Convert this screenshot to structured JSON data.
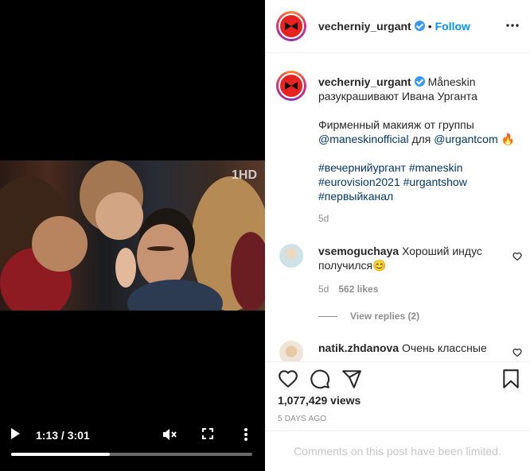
{
  "video": {
    "channel_logo": "1HD",
    "time": "1:13 / 3:01",
    "progress": 0.41,
    "icons": [
      "play-icon",
      "mute-icon",
      "fullscreen-icon",
      "more-vertical-icon"
    ]
  },
  "header": {
    "username": "vecherniy_urgant",
    "separator": "•",
    "follow_label": "Follow"
  },
  "caption": {
    "username": "vecherniy_urgant",
    "line1": "Måneskin разукрашивают Ивана Урганта",
    "line2_prefix": "Фирменный макияж от группы",
    "mention1": "@maneskinofficial",
    "line2_mid": "для",
    "mention2": "@urgantcom",
    "emoji": "🔥",
    "hashtags": [
      "#вечернийургант",
      "#maneskin",
      "#eurovision2021",
      "#urgantshow",
      "#первыйканал"
    ],
    "age": "5d"
  },
  "comments": [
    {
      "username": "vsemoguchaya",
      "text": "Хороший индус получился😊",
      "age": "5d",
      "likes": "562 likes",
      "view_replies": "View replies (2)"
    },
    {
      "username": "natik.zhdanova",
      "text": "Очень классные"
    }
  ],
  "footer": {
    "views": "1,077,429 views",
    "date": "5 DAYS AGO",
    "limited_text": "Comments on this post have been limited."
  },
  "colors": {
    "follow": "#0095f6",
    "verified": "#3897f0",
    "link": "#00376b",
    "avatar_red": "#e6231f"
  }
}
